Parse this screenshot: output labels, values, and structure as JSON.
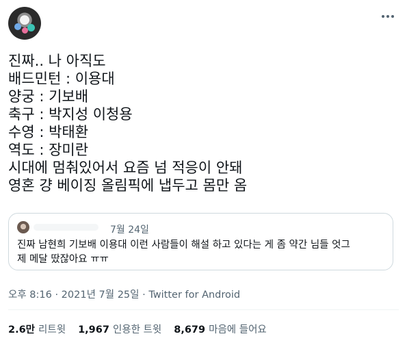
{
  "tweet": {
    "avatar_icon": "profile-avatar",
    "more_icon": "more-options-icon",
    "lines": [
      "진짜.. 나 아직도",
      "배드민턴 : 이용대",
      "양궁 : 기보배",
      "축구 : 박지성 이청용",
      "수영 : 박태환",
      "역도 : 장미란",
      "시대에 멈춰있어서 요즘 넘 적응이 안돼",
      "영혼 걍 베이징 올림픽에 냅두고 몸만 옴"
    ],
    "quote": {
      "date": "7월 24일",
      "text_line1": "진짜 남현희 기보배 이용대 이런 사람들이 해설 하고 있다는 게 좀 약간 님들 엇그",
      "text_line2": "제 메달 땄잖아요 ㅠㅠ"
    },
    "meta": "오후 8:16 · 2021년 7월 25일 · Twitter for Android",
    "stats": {
      "retweets_count": "2.6만",
      "retweets_label": "리트윗",
      "quotes_count": "1,967",
      "quotes_label": "인용한 트윗",
      "likes_count": "8,679",
      "likes_label": "마음에 들어요"
    }
  }
}
